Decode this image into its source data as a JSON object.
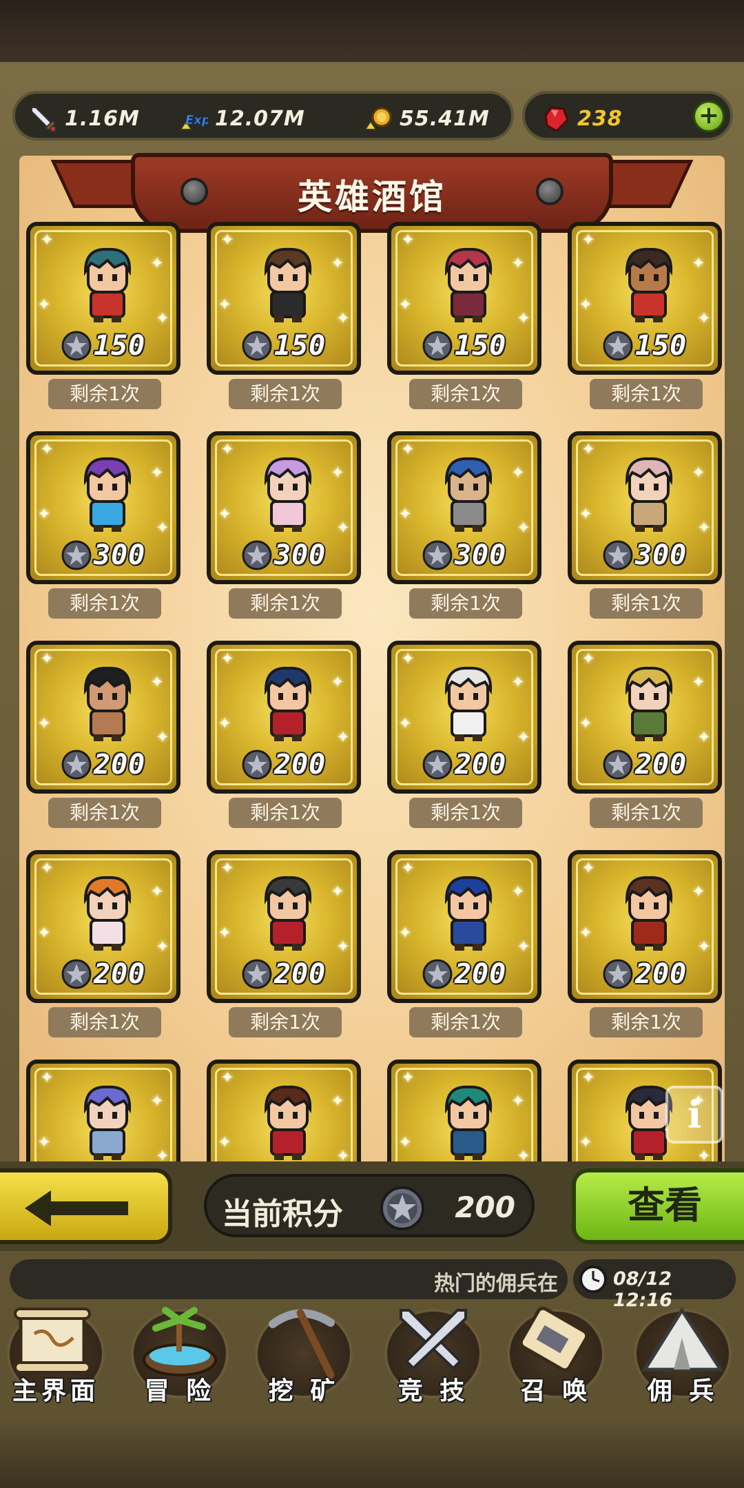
{
  "resources": {
    "attack": "1.16M",
    "exp_badge": "Exp",
    "exp": "12.07M",
    "gold": "55.41M",
    "gems": "238"
  },
  "banner": {
    "title": "英雄酒馆"
  },
  "heroes": [
    {
      "cost": "150",
      "remain": "剩余1次",
      "hair": "#2f6f7a",
      "outfit": "#c8332b",
      "skin": "#f3c7a2"
    },
    {
      "cost": "150",
      "remain": "剩余1次",
      "hair": "#5a3a22",
      "outfit": "#2b2b2b",
      "skin": "#f3c7a2"
    },
    {
      "cost": "150",
      "remain": "剩余1次",
      "hair": "#b3364a",
      "outfit": "#7a2a3a",
      "skin": "#f3c7a2"
    },
    {
      "cost": "150",
      "remain": "剩余1次",
      "hair": "#3a2a20",
      "outfit": "#c8332b",
      "skin": "#b87a4a"
    },
    {
      "cost": "300",
      "remain": "剩余1次",
      "hair": "#7a3fb0",
      "outfit": "#39a8e0",
      "skin": "#f3c7a2"
    },
    {
      "cost": "300",
      "remain": "剩余1次",
      "hair": "#c79be0",
      "outfit": "#f0c8d8",
      "skin": "#f3d2bb"
    },
    {
      "cost": "300",
      "remain": "剩余1次",
      "hair": "#2f5fb0",
      "outfit": "#8a8a8a",
      "skin": "#d9b48a"
    },
    {
      "cost": "300",
      "remain": "剩余1次",
      "hair": "#e0b5b5",
      "outfit": "#c8a87a",
      "skin": "#f3d2bb"
    },
    {
      "cost": "200",
      "remain": "剩余1次",
      "hair": "#1f1f1f",
      "outfit": "#b47a52",
      "skin": "#d29a74"
    },
    {
      "cost": "200",
      "remain": "剩余1次",
      "hair": "#1f3a6a",
      "outfit": "#b3222a",
      "skin": "#f3c7a2"
    },
    {
      "cost": "200",
      "remain": "剩余1次",
      "hair": "#e6e6e6",
      "outfit": "#f0f0f0",
      "skin": "#f3c7a2"
    },
    {
      "cost": "200",
      "remain": "剩余1次",
      "hair": "#d8b84a",
      "outfit": "#5a7a3a",
      "skin": "#f3d2bb"
    },
    {
      "cost": "200",
      "remain": "剩余1次",
      "hair": "#e07a2a",
      "outfit": "#f3e0e6",
      "skin": "#f3d2bb"
    },
    {
      "cost": "200",
      "remain": "剩余1次",
      "hair": "#3a3a3a",
      "outfit": "#b3222a",
      "skin": "#f3c7a2"
    },
    {
      "cost": "200",
      "remain": "剩余1次",
      "hair": "#1f3fa0",
      "outfit": "#2a4aa0",
      "skin": "#f3c7a2"
    },
    {
      "cost": "200",
      "remain": "剩余1次",
      "hair": "#5a3320",
      "outfit": "#a02a1a",
      "skin": "#f3c7a2"
    },
    {
      "cost": "",
      "remain": "",
      "hair": "#6a6ad0",
      "outfit": "#8aa8d0",
      "skin": "#f3d2bb"
    },
    {
      "cost": "",
      "remain": "",
      "hair": "#5a2a1a",
      "outfit": "#b3222a",
      "skin": "#f3c7a2"
    },
    {
      "cost": "",
      "remain": "",
      "hair": "#1f8a7a",
      "outfit": "#2a5a8a",
      "skin": "#f3c7a2"
    },
    {
      "cost": "",
      "remain": "",
      "hair": "#2a2a3a",
      "outfit": "#b3222a",
      "skin": "#f3c7a2"
    }
  ],
  "info_button": {
    "label": "i"
  },
  "actions": {
    "score_label": "当前积分",
    "score_value": "200",
    "view_label": "查看"
  },
  "ticker": {
    "text": "热门的佣兵在",
    "datetime": "08/12 12:16"
  },
  "nav": [
    {
      "label": "主界面",
      "icon": "scroll-map-icon"
    },
    {
      "label": "冒 险",
      "icon": "island-icon"
    },
    {
      "label": "挖 矿",
      "icon": "pickaxe-icon"
    },
    {
      "label": "竞 技",
      "icon": "crossed-swords-icon"
    },
    {
      "label": "召 唤",
      "icon": "summon-scroll-icon"
    },
    {
      "label": "佣 兵",
      "icon": "tent-icon"
    }
  ],
  "colors": {
    "accent_green": "#8bd42a",
    "accent_yellow": "#e8cf2a",
    "banner_red": "#8a2e1c",
    "parchment": "#f6d9a8"
  }
}
